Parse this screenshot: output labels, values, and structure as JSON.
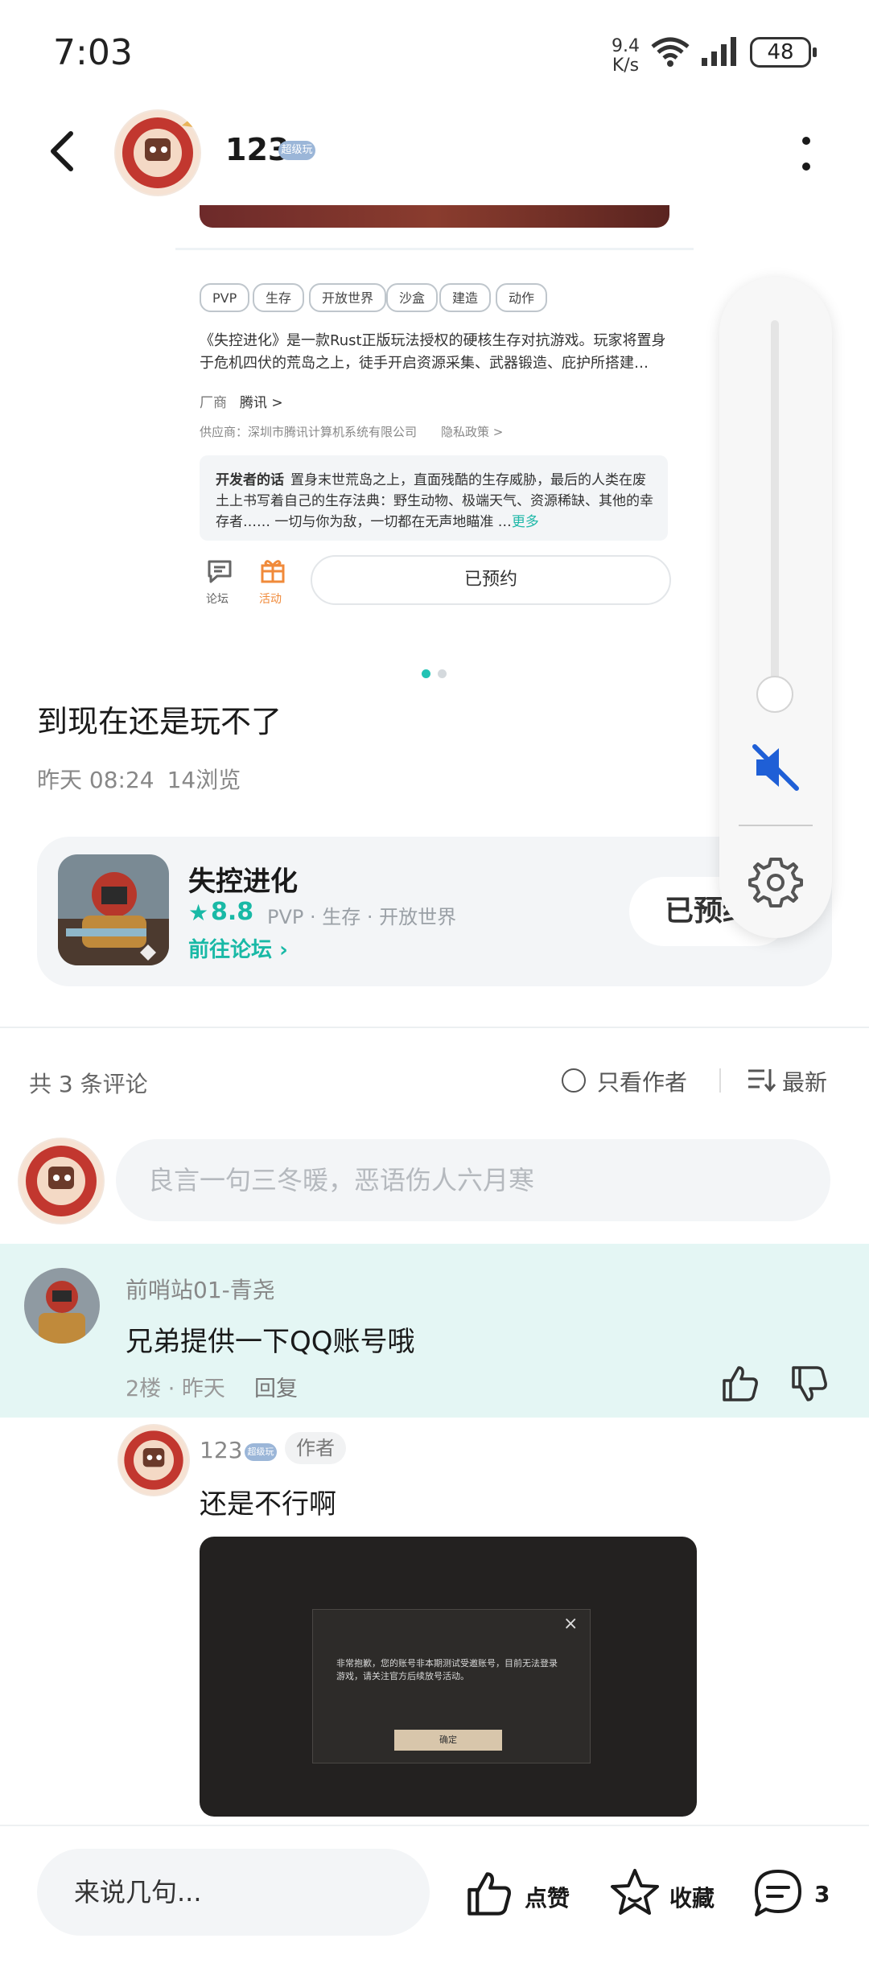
{
  "status_bar": {
    "time": "7:03",
    "net_speed_value": "9.4",
    "net_speed_unit": "K/s",
    "battery": "48"
  },
  "header": {
    "username": "123",
    "badge": "超级玩"
  },
  "shared_screenshot": {
    "tags": [
      "PVP",
      "生存",
      "开放世界",
      "沙盒",
      "建造",
      "动作"
    ],
    "description": "《失控进化》是一款Rust正版玩法授权的硬核生存对抗游戏。玩家将置身于危机四伏的荒岛之上，徒手开启资源采集、武器锻造、庇护所搭建…",
    "vendor_label": "厂商",
    "vendor": "腾讯 >",
    "supplier": "供应商：深圳市腾讯计算机系统有限公司　　隐私政策 >",
    "dev_title": "开发者的话",
    "dev_text": "置身末世荒岛之上，直面残酷的生存威胁，最后的人类在废土上书写着自己的生存法典：野生动物、极端天气、资源稀缺、其他的幸存者…… 一切与你为敌，一切都在无声地瞄准 …",
    "dev_more": "更多",
    "forum_label": "论坛",
    "activity_label": "活动",
    "reserved_label": "已预约"
  },
  "post": {
    "text": "到现在还是玩不了",
    "time": "昨天 08:24",
    "views": "14浏览"
  },
  "game_card": {
    "name": "失控进化",
    "rating": "8.8",
    "tags": "PVP · 生存 · 开放世界",
    "forum_link": "前往论坛",
    "reserve_button": "已预约"
  },
  "comments_header": {
    "count": "共 3 条评论",
    "only_author": "只看作者",
    "sort": "最新"
  },
  "comment_input": {
    "placeholder": "良言一句三冬暖，恶语伤人六月寒"
  },
  "comments": [
    {
      "user": "前哨站01-青尧",
      "text": "兄弟提供一下QQ账号哦",
      "floor": "2楼 · 昨天",
      "reply": "回复"
    }
  ],
  "reply": {
    "user": "123",
    "badge": "超级玩",
    "author_tag": "作者",
    "text": "还是不行啊",
    "image_dialog": {
      "text": "非常抱歉，您的账号非本期测试受邀账号，目前无法登录游戏，请关注官方后续放号活动。",
      "ok": "确定",
      "close": "×"
    }
  },
  "bottom_bar": {
    "input_placeholder": "来说几句...",
    "like": "点赞",
    "favorite": "收藏",
    "comment_count": "3"
  },
  "colors": {
    "accent": "#19b9a6",
    "highlight_bg": "#e4f6f4",
    "mute_blue": "#1f5fd6"
  },
  "volume": {
    "level": 0.06,
    "muted": true
  },
  "pager": {
    "current": 1,
    "total": 2
  }
}
